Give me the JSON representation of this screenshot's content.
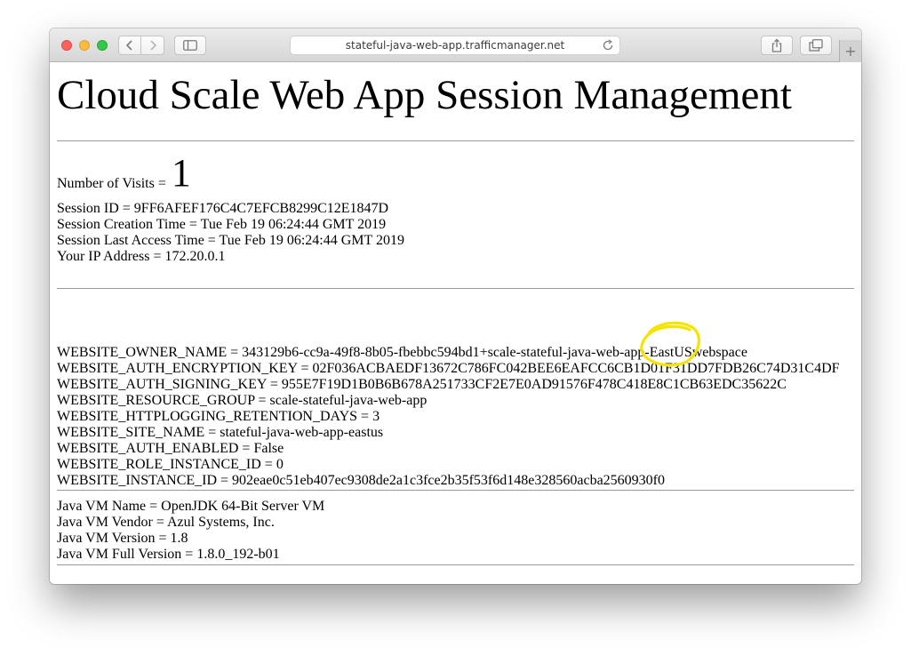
{
  "browser": {
    "url": "stateful-java-web-app.trafficmanager.net",
    "new_tab_label": "+",
    "back_label": "‹",
    "forward_label": "›"
  },
  "page": {
    "title": "Cloud Scale Web App Session Management",
    "visits_label": "Number of Visits =",
    "visits_count": "1",
    "session_lines": [
      "Session ID = 9FF6AFEF176C4C7EFCB8299C12E1847D",
      "Session Creation Time = Tue Feb 19 06:24:44 GMT 2019",
      "Session Last Access Time = Tue Feb 19 06:24:44 GMT 2019",
      "Your IP Address = 172.20.0.1"
    ],
    "env_lines": [
      "WEBSITE_OWNER_NAME = 343129b6-cc9a-49f8-8b05-fbebbc594bd1+scale-stateful-java-web-app-EastUSwebspace",
      "WEBSITE_AUTH_ENCRYPTION_KEY = 02F036ACBAEDF13672C786FC042BEE6EAFCC6CB1D01F31DD7FDB26C74D31C4DF",
      "WEBSITE_AUTH_SIGNING_KEY = 955E7F19D1B0B6B678A251733CF2E7E0AD91576F478C418E8C1CB63EDC35622C",
      "WEBSITE_RESOURCE_GROUP = scale-stateful-java-web-app",
      "WEBSITE_HTTPLOGGING_RETENTION_DAYS = 3",
      "WEBSITE_SITE_NAME = stateful-java-web-app-eastus",
      "WEBSITE_AUTH_ENABLED = False",
      "WEBSITE_ROLE_INSTANCE_ID = 0",
      "WEBSITE_INSTANCE_ID = 902eae0c51eb407ec9308de2a1c3fce2b35f53f6d148e328560acba2560930f0"
    ],
    "jvm_lines": [
      "Java VM Name = OpenJDK 64-Bit Server VM",
      "Java VM Vendor = Azul Systems, Inc.",
      "Java VM Version = 1.8",
      "Java VM Full Version = 1.8.0_192-b01"
    ]
  },
  "colors": {
    "annotation": "#f5e400",
    "close": "#fc605c",
    "minimize": "#fdbc40",
    "zoom": "#34c84a"
  }
}
